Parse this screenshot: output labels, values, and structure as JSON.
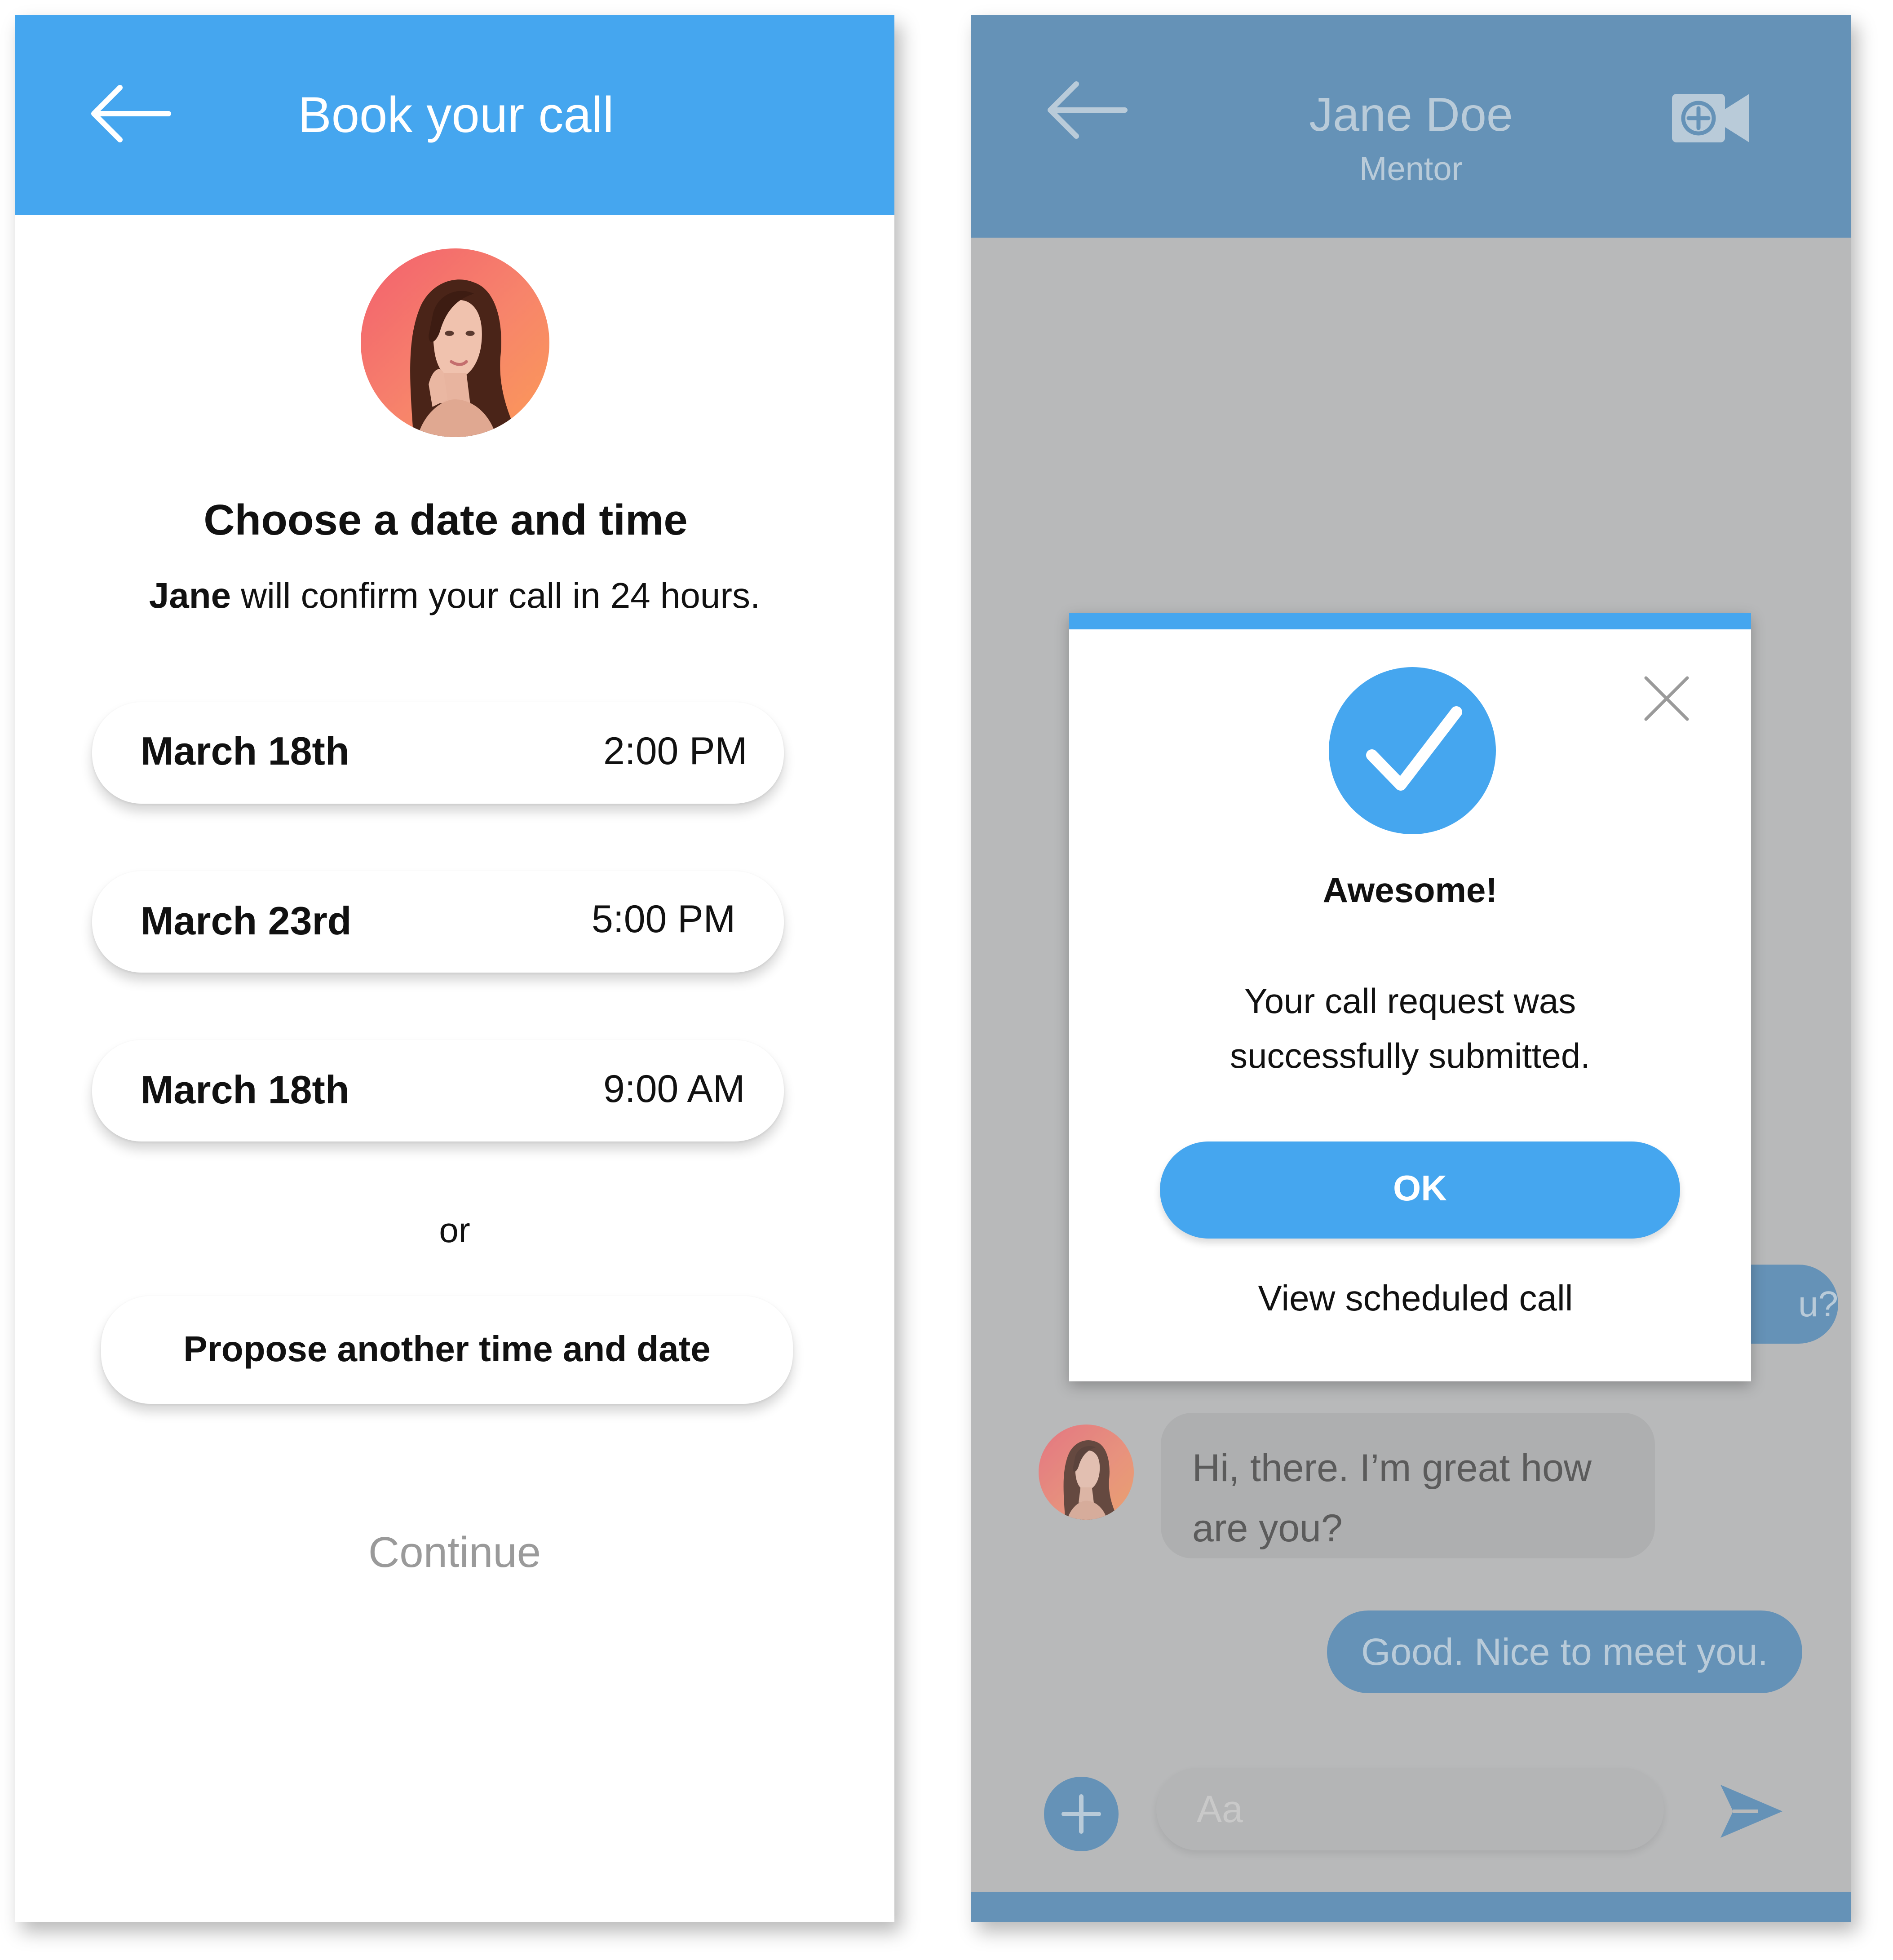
{
  "left_screen": {
    "appbar": {
      "title": "Book your call",
      "back_icon": "arrow-left-icon"
    },
    "avatar": {
      "icon": "profile-photo"
    },
    "heading": "Choose a date and time",
    "subheading": {
      "name": "Jane",
      "rest": " will confirm your call in 24 hours."
    },
    "slots": [
      {
        "date": "March 18th",
        "time": "2:00 PM"
      },
      {
        "date": "March 23rd",
        "time": "5:00 PM"
      },
      {
        "date": "March 18th",
        "time": "9:00 AM"
      }
    ],
    "or_label": "or",
    "propose_label": "Propose another time and date",
    "continue_label": "Continue"
  },
  "right_screen": {
    "appbar": {
      "name": "Jane Doe",
      "role": "Mentor",
      "back_icon": "arrow-left-icon",
      "video_icon": "video-call-add-icon"
    },
    "messages": {
      "partial_outgoing": "u?",
      "incoming": "Hi, there. I’m great how are you?",
      "outgoing": "Good. Nice to meet you."
    },
    "composer": {
      "placeholder": "Aa",
      "add_icon": "plus-circle-icon",
      "send_icon": "send-icon"
    },
    "modal": {
      "check_icon": "check-circle-icon",
      "close_icon": "close-icon",
      "title": "Awesome!",
      "message_line1": "Your call request was",
      "message_line2": "successfully submitted.",
      "ok_label": "OK",
      "view_label": "View scheduled call"
    }
  },
  "colors": {
    "accent_blue": "#45a6ef",
    "dimmed_appbar": "#6592b7",
    "overlay_gray": "#b8b9ba",
    "muted_text": "#9a9a9a"
  }
}
